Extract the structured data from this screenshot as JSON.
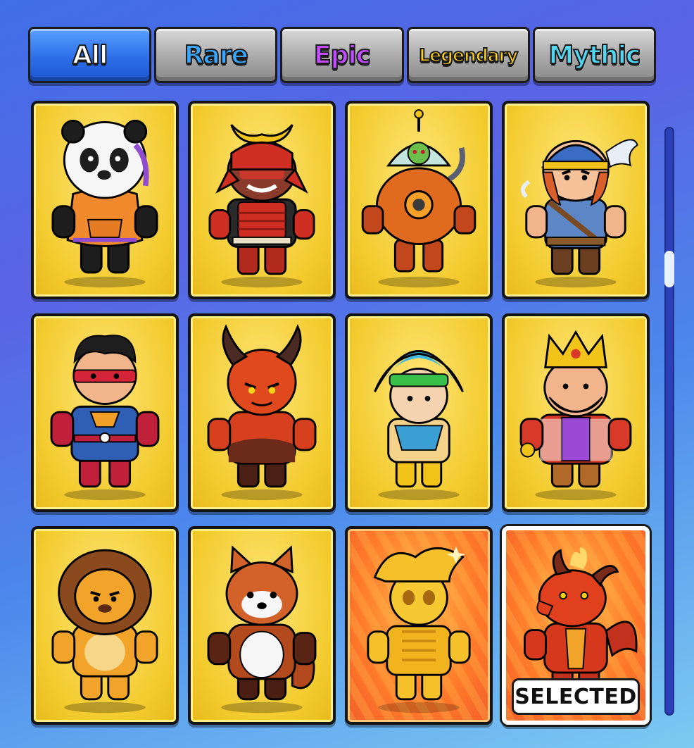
{
  "tabs": [
    {
      "label": "All",
      "color": "#ffffff",
      "active": true
    },
    {
      "label": "Rare",
      "color": "#39a7ff",
      "active": false
    },
    {
      "label": "Epic",
      "color": "#c04bff",
      "active": false
    },
    {
      "label": "Legendary",
      "color": "#ffd21f",
      "active": false
    },
    {
      "label": "Mythic",
      "color": "#53d6f2",
      "active": false
    }
  ],
  "characters": [
    {
      "icon": "panda-character-icon",
      "rarity_color": "#f3cb2e"
    },
    {
      "icon": "samurai-character-icon",
      "rarity_color": "#f3cb2e"
    },
    {
      "icon": "robot-diver-character-icon",
      "rarity_color": "#f3cb2e"
    },
    {
      "icon": "viking-warrior-character-icon",
      "rarity_color": "#f3cb2e"
    },
    {
      "icon": "superhero-character-icon",
      "rarity_color": "#f3cb2e"
    },
    {
      "icon": "devil-character-icon",
      "rarity_color": "#f3cb2e"
    },
    {
      "icon": "aztec-warrior-character-icon",
      "rarity_color": "#f3cb2e"
    },
    {
      "icon": "king-character-icon",
      "rarity_color": "#f3cb2e"
    },
    {
      "icon": "lion-character-icon",
      "rarity_color": "#f3cb2e"
    },
    {
      "icon": "red-panda-character-icon",
      "rarity_color": "#f3cb2e"
    },
    {
      "icon": "golden-pirate-character-icon",
      "rarity_color": "#ff7a2a"
    },
    {
      "icon": "fire-dragon-character-icon",
      "rarity_color": "#ff7a2a"
    }
  ],
  "selected_badge": "SELECTED"
}
